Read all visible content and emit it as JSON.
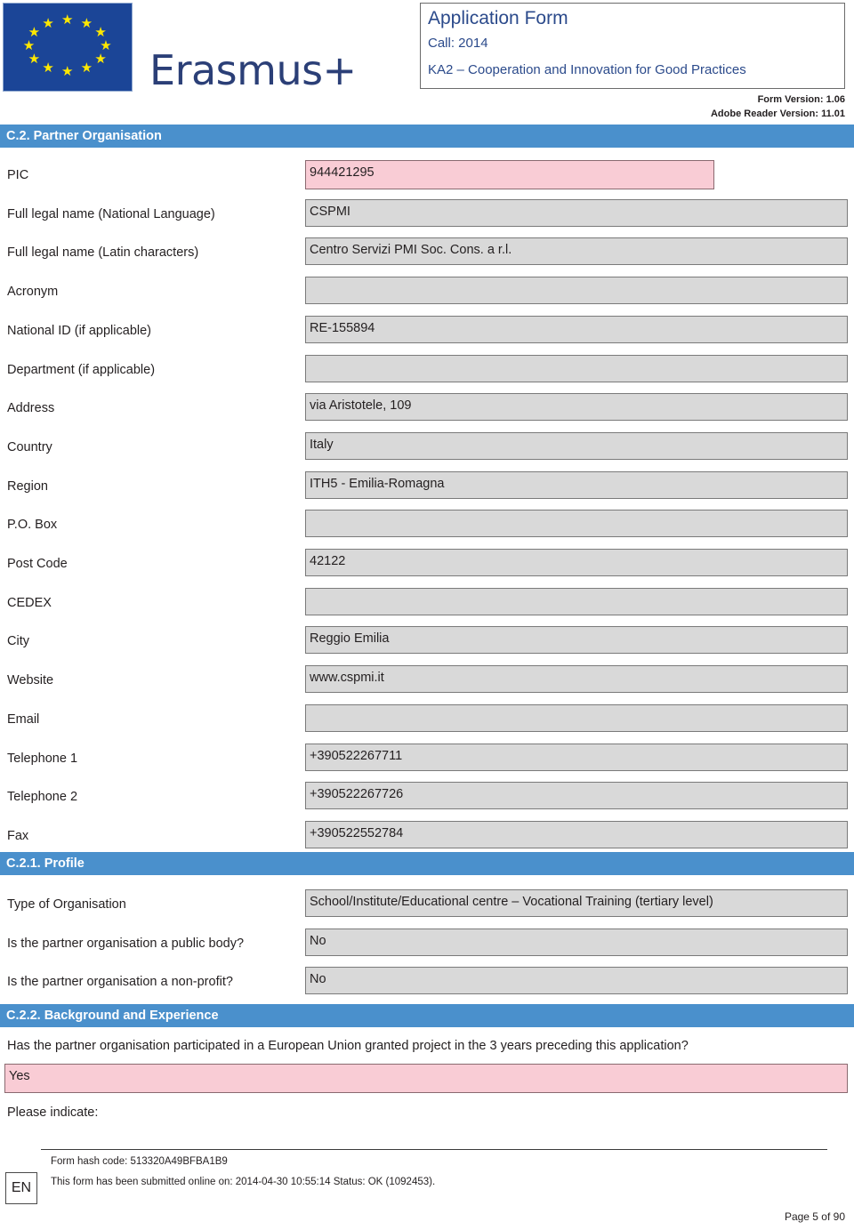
{
  "header": {
    "logo_alt": "European Union flag",
    "brand": "Erasmus+",
    "title": "Application Form",
    "call": "Call: 2014",
    "action": "KA2 – Cooperation and Innovation for Good Practices",
    "form_version": "Form Version: 1.06",
    "reader_version": "Adobe Reader Version: 11.01"
  },
  "sections": {
    "partner_organisation": "C.2. Partner Organisation",
    "profile": "C.2.1. Profile",
    "background": "C.2.2. Background and Experience"
  },
  "organisation_fields": [
    {
      "label": "PIC",
      "value": "944421295",
      "highlight": "pink"
    },
    {
      "label": "Full legal name (National Language)",
      "value": "CSPMI",
      "highlight": "grey"
    },
    {
      "label": "Full legal name (Latin characters)",
      "value": "Centro Servizi PMI Soc. Cons. a r.l.",
      "highlight": "grey"
    },
    {
      "label": "Acronym",
      "value": "",
      "highlight": "grey"
    },
    {
      "label": "National ID (if applicable)",
      "value": "RE-155894",
      "highlight": "grey"
    },
    {
      "label": "Department (if applicable)",
      "value": "",
      "highlight": "grey"
    },
    {
      "label": "Address",
      "value": "via Aristotele, 109",
      "highlight": "grey"
    },
    {
      "label": "Country",
      "value": "Italy",
      "highlight": "grey"
    },
    {
      "label": "Region",
      "value": "ITH5 - Emilia-Romagna",
      "highlight": "grey"
    },
    {
      "label": "P.O. Box",
      "value": "",
      "highlight": "grey"
    },
    {
      "label": "Post Code",
      "value": "42122",
      "highlight": "grey"
    },
    {
      "label": "CEDEX",
      "value": "",
      "highlight": "grey"
    },
    {
      "label": "City",
      "value": "Reggio Emilia",
      "highlight": "grey"
    },
    {
      "label": "Website",
      "value": "www.cspmi.it",
      "highlight": "grey"
    },
    {
      "label": "Email",
      "value": "",
      "highlight": "grey"
    },
    {
      "label": "Telephone 1",
      "value": "+390522267711",
      "highlight": "grey"
    },
    {
      "label": "Telephone 2",
      "value": "+390522267726",
      "highlight": "grey"
    },
    {
      "label": "Fax",
      "value": "+390522552784",
      "highlight": "grey"
    }
  ],
  "profile_fields": [
    {
      "label": "Type of Organisation",
      "value": "School/Institute/Educational centre – Vocational Training (tertiary level)"
    },
    {
      "label": "Is the partner organisation a public body?",
      "value": "No"
    },
    {
      "label": "Is the partner organisation a non-profit?",
      "value": "No"
    }
  ],
  "background": {
    "question": "Has the partner organisation participated in a European Union granted project in the 3 years preceding this application?",
    "answer": "Yes",
    "please_indicate": "Please indicate:"
  },
  "footer": {
    "language": "EN",
    "hash": "Form hash code: 513320A49BFBA1B9",
    "submitted": "This form has been submitted online on: 2014-04-30 10:55:14 Status: OK (1092453).",
    "page": "Page 5 of 90"
  },
  "colors": {
    "section_bar": "#4a90cc",
    "field_grey": "#d9d9d9",
    "field_pink": "#f9ccd5",
    "brand_blue": "#2b4a8b",
    "flag_blue": "#1b4597",
    "star_yellow": "#ffe800"
  }
}
